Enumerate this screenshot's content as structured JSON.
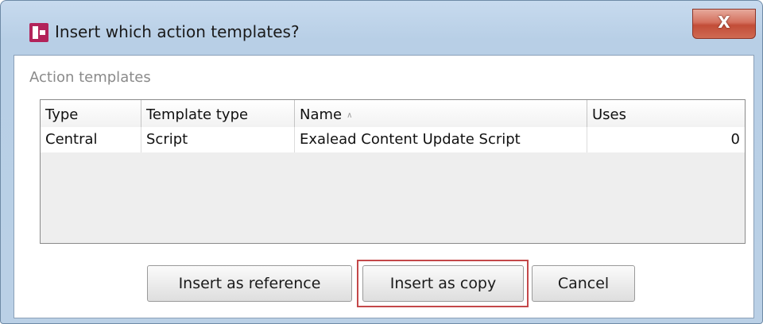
{
  "window": {
    "title": "Insert which action templates?",
    "close_symbol": "X"
  },
  "group": {
    "label": "Action templates"
  },
  "table": {
    "columns": [
      "Type",
      "Template type",
      "Name",
      "Uses"
    ],
    "sorted_column_icon": "sort-ascending-icon",
    "sort_glyph": "∧",
    "rows": [
      [
        "Central",
        "Script",
        "Exalead Content Update Script",
        "0"
      ]
    ]
  },
  "buttons": {
    "insert_reference": "Insert as reference",
    "insert_copy": "Insert as copy",
    "cancel": "Cancel"
  },
  "colors": {
    "highlight": "#c4484a",
    "app_icon": "#b2235a",
    "close_button": "#c24d38"
  }
}
